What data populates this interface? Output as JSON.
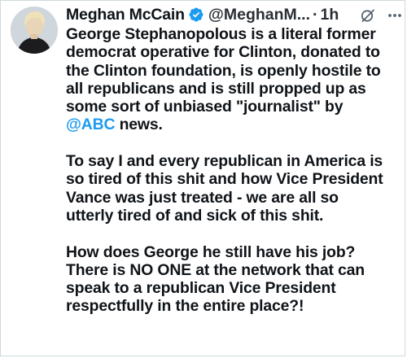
{
  "author": {
    "name": "Meghan McCain",
    "handle": "@MeghanM...",
    "separator": "·",
    "time": "1h"
  },
  "icons": {
    "avatar": "profile-photo",
    "verified": "verified-badge-icon",
    "grok": "grok-icon",
    "more": "more-icon"
  },
  "colors": {
    "verified": "#1d9bf0",
    "mention": "#1d9bf0",
    "text": "#0f1419"
  },
  "tweet": {
    "p1": {
      "line1": "George Stephanopolous is a literal former",
      "line2": "democrat operative for Clinton, donated to",
      "line3": "the Clinton foundation, is openly hostile to",
      "line4": "all republicans and is still propped up as",
      "line5": "some sort of unbiased \"journalist\" by",
      "mention": "@ABC",
      "line6_tail": " news."
    },
    "p2": {
      "line1": "To say I and every republican in America is",
      "line2": "so tired of this shit and how Vice President",
      "line3": "Vance was just treated - we are all so",
      "line4": "utterly tired of and sick of this shit."
    },
    "p3": {
      "line1": "How does George he still have his job?",
      "line2": "There is NO ONE at the network that can",
      "line3": "speak to a republican Vice President",
      "line4": "respectfully in the entire place?!"
    }
  }
}
